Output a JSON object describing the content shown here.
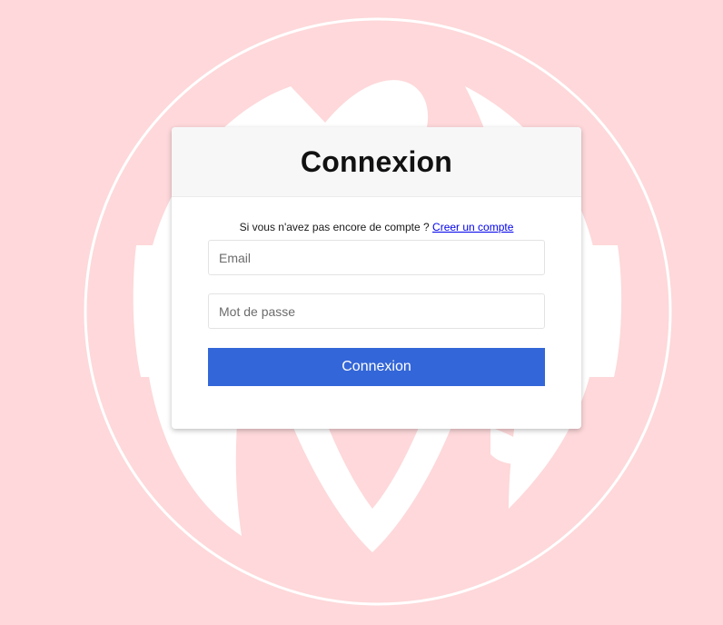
{
  "colors": {
    "background": "#fed8da",
    "primary_button": "#3366d8",
    "link": "#0000ee"
  },
  "background_logo": {
    "icon": "wordpress-logo-icon"
  },
  "login": {
    "title": "Connexion",
    "register_prompt": "Si vous n'avez pas encore de compte ?",
    "register_link": "Creer un compte",
    "email_placeholder": "Email",
    "email_value": "",
    "password_placeholder": "Mot de passe",
    "password_value": "",
    "submit_label": "Connexion"
  }
}
